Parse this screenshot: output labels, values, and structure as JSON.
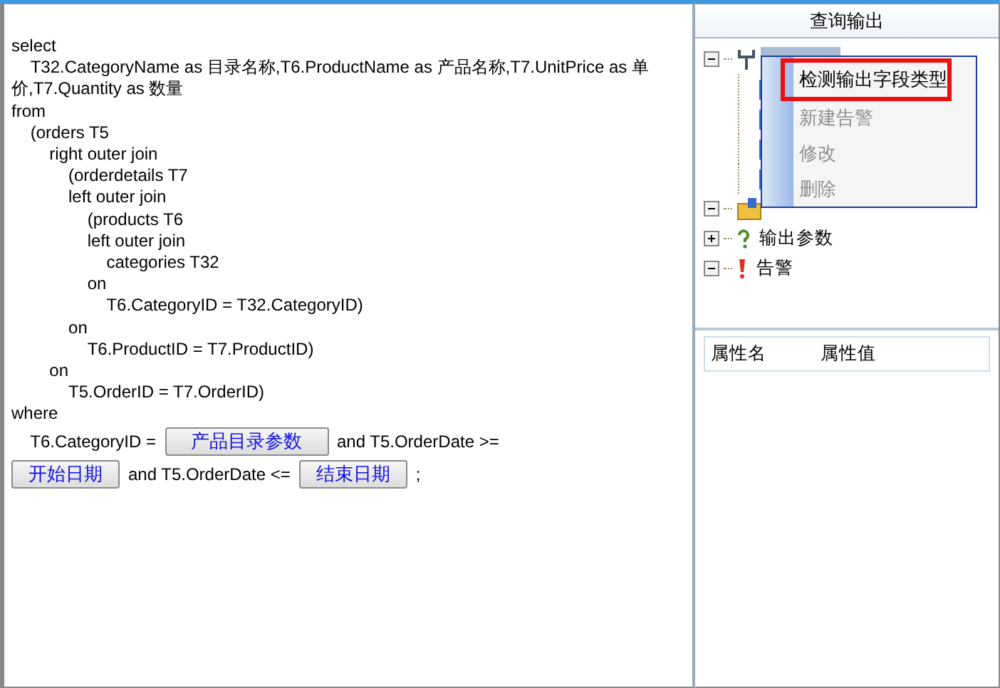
{
  "sql_lines": [
    "select",
    "    T32.CategoryName as 目录名称,T6.ProductName as 产品名称,T7.UnitPrice as 单价,T7.Quantity as 数量",
    "from",
    "    (orders T5",
    "        right outer join",
    "            (orderdetails T7",
    "            left outer join",
    "                (products T6",
    "                left outer join",
    "                    categories T32",
    "                on",
    "                    T6.CategoryID = T32.CategoryID)",
    "            on",
    "                T6.ProductID = T7.ProductID)",
    "        on",
    "            T5.OrderID = T7.OrderID)",
    "where"
  ],
  "where_lines": [
    [
      {
        "kind": "text",
        "text": "    T6.CategoryID ="
      },
      {
        "kind": "param",
        "text": "产品目录参数"
      },
      {
        "kind": "text",
        "text": "and T5.OrderDate >="
      }
    ],
    [
      {
        "kind": "param",
        "text": "开始日期"
      },
      {
        "kind": "text",
        "text": "and T5.OrderDate <="
      },
      {
        "kind": "param",
        "text": "结束日期"
      },
      {
        "kind": "text",
        "text": ";"
      }
    ]
  ],
  "panel_title": "查询输出",
  "tree": [
    {
      "kind": "fields",
      "expanded": true,
      "selected": true,
      "children": [
        {
          "kind": "field"
        },
        {
          "kind": "field"
        },
        {
          "kind": "field"
        },
        {
          "kind": "field"
        }
      ]
    },
    {
      "kind": "input",
      "expanded": true
    },
    {
      "kind": "output",
      "label": "输出参数",
      "expanded": false,
      "selected": false
    },
    {
      "kind": "alert",
      "label": "告警",
      "expanded": true,
      "selected": false
    }
  ],
  "context_menu": [
    {
      "label": "检测输出字段类型",
      "disabled": false,
      "selected": true
    },
    {
      "label": "新建告警",
      "disabled": true,
      "selected": false
    },
    {
      "label": "修改",
      "disabled": true,
      "selected": false
    },
    {
      "label": "删除",
      "disabled": true,
      "selected": false
    }
  ],
  "properties": {
    "columns": [
      "属性名",
      "属性值"
    ]
  }
}
